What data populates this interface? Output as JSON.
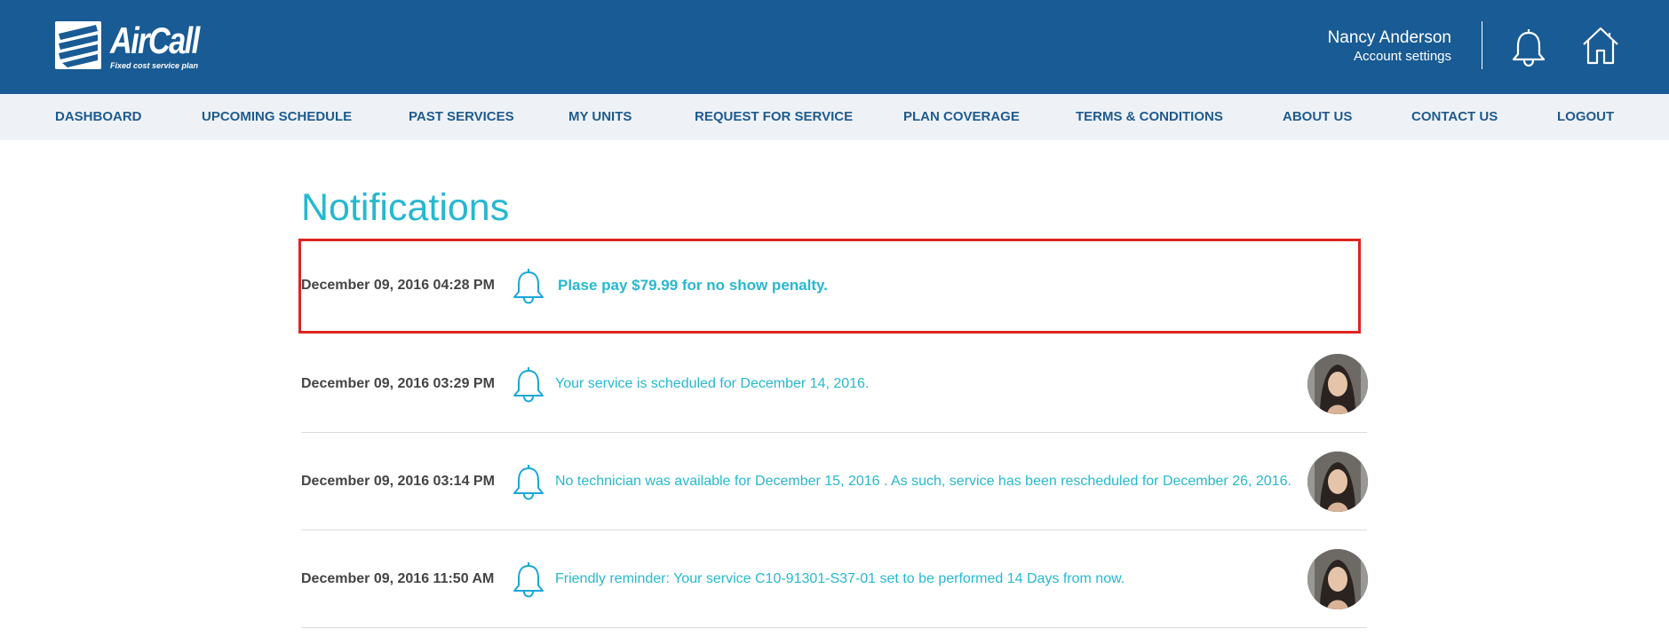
{
  "app": {
    "logo_word": "AirCall",
    "logo_tagline": "Fixed cost service plan"
  },
  "header": {
    "user_name": "Nancy Anderson",
    "account_settings": "Account settings",
    "icons": [
      "bell-icon",
      "home-icon"
    ]
  },
  "nav": {
    "items": [
      {
        "label": "DASHBOARD"
      },
      {
        "label": "UPCOMING SCHEDULE"
      },
      {
        "label": "PAST SERVICES"
      },
      {
        "label": "MY UNITS"
      },
      {
        "label": "REQUEST FOR SERVICE"
      },
      {
        "label": "PLAN COVERAGE"
      },
      {
        "label": "TERMS & CONDITIONS"
      },
      {
        "label": "ABOUT US"
      },
      {
        "label": "CONTACT US"
      },
      {
        "label": "LOGOUT"
      }
    ]
  },
  "main": {
    "title": "Notifications",
    "notifications": [
      {
        "timestamp": "December 09, 2016 04:28 PM",
        "message": "Plase pay $79.99 for no show penalty.",
        "highlighted": true,
        "has_avatar": false
      },
      {
        "timestamp": "December 09, 2016 03:29 PM",
        "message": "Your service is scheduled for December 14, 2016.",
        "highlighted": false,
        "has_avatar": true
      },
      {
        "timestamp": "December 09, 2016 03:14 PM",
        "message": "No technician was available for December 15, 2016 . As such, service has been rescheduled for December 26, 2016.",
        "highlighted": false,
        "has_avatar": true
      },
      {
        "timestamp": "December 09, 2016 11:50 AM",
        "message": "Friendly reminder: Your service C10-91301-S37-01 set to be performed 14 Days from now.",
        "highlighted": false,
        "has_avatar": true
      }
    ]
  },
  "colors": {
    "header_bg": "#195b94",
    "nav_bg": "#eef2f7",
    "nav_text": "#1f5a8e",
    "accent": "#26b8cf",
    "highlight_border": "#e0241f"
  }
}
